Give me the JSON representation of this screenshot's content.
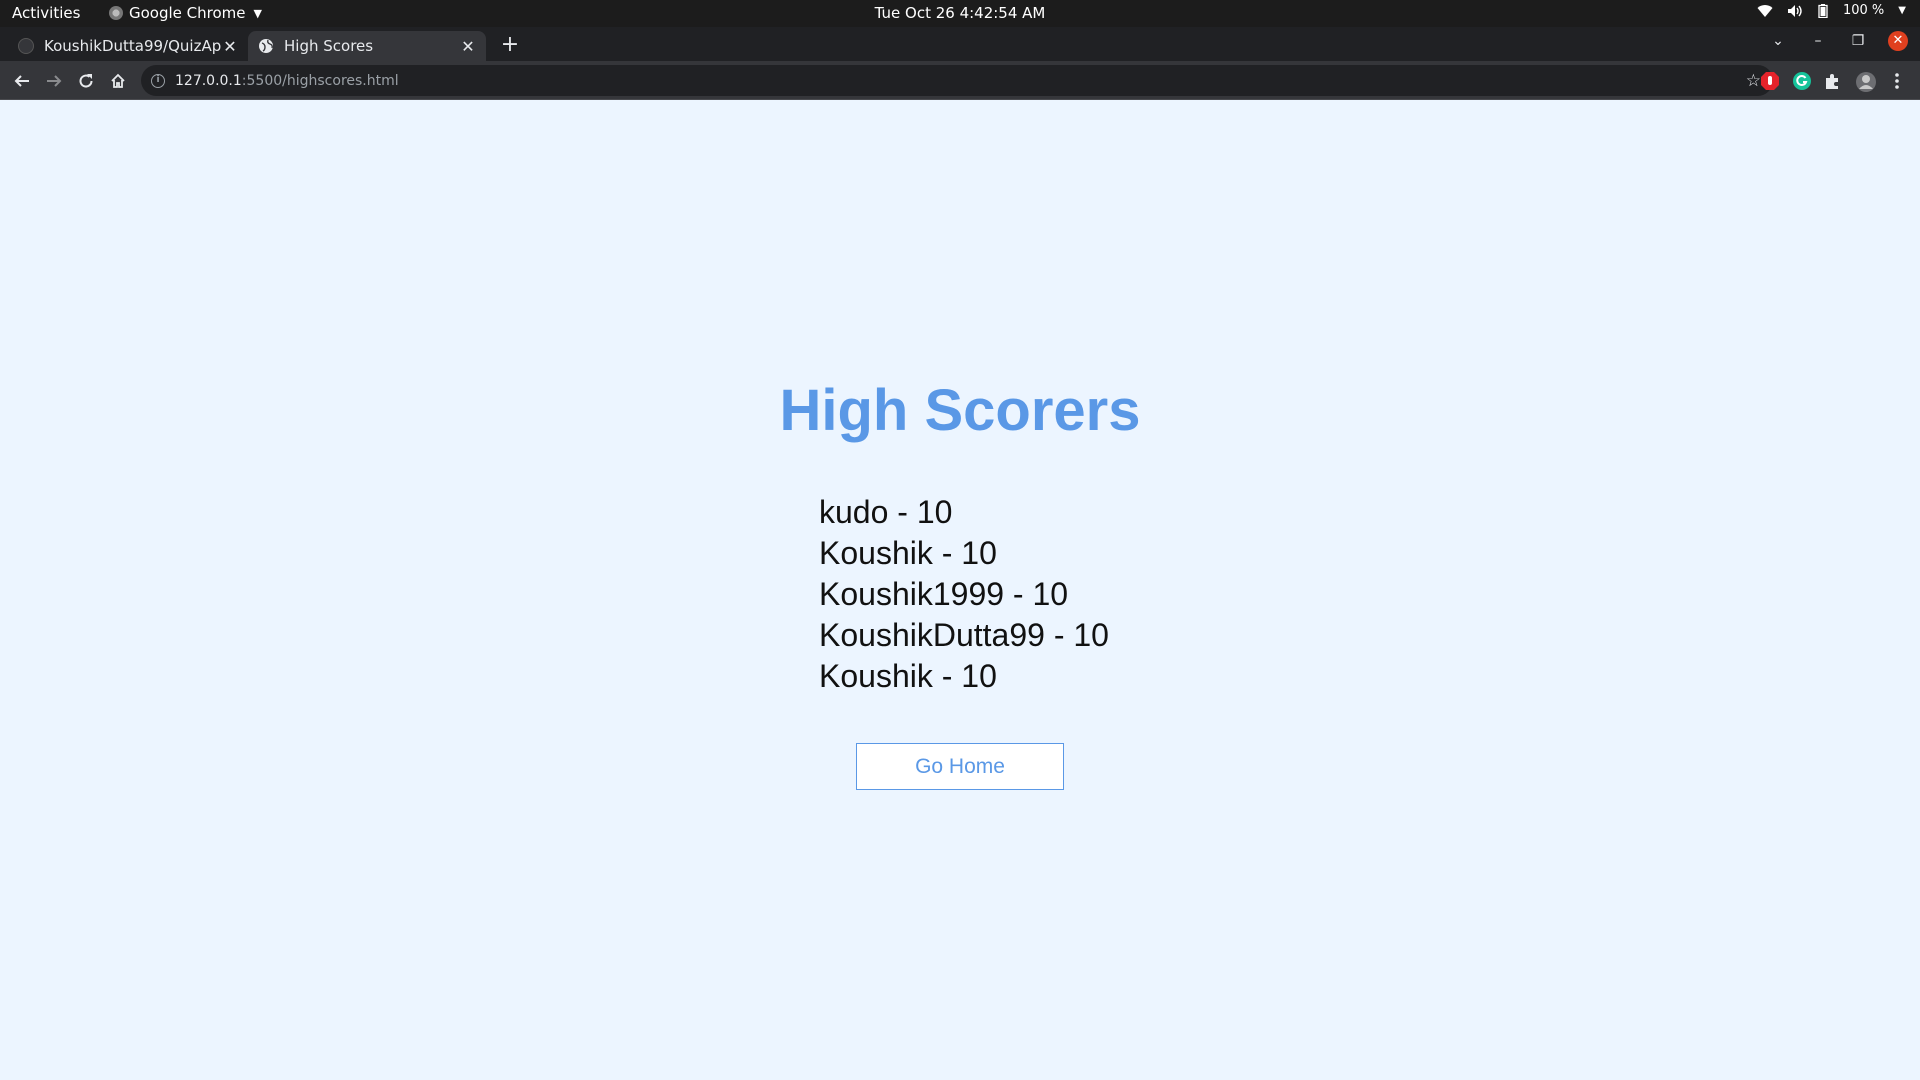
{
  "system_bar": {
    "activities": "Activities",
    "app_name": "Google Chrome",
    "clock": "Tue Oct 26  4:42:54 AM",
    "battery": "100 %"
  },
  "browser": {
    "tabs": [
      {
        "title": "KoushikDutta99/QuizApp",
        "active": false
      },
      {
        "title": "High Scores",
        "active": true
      }
    ],
    "address": {
      "host": "127.0.0.1",
      "path": ":5500/highscores.html"
    }
  },
  "page": {
    "title": "High Scorers",
    "scores": [
      "kudo - 10",
      "Koushik - 10",
      "Koushik1999 - 10",
      "KoushikDutta99 - 10",
      "Koushik - 10"
    ],
    "go_home_label": "Go Home"
  },
  "colors": {
    "page_background": "#ecf5ff",
    "accent": "#5a98e6",
    "toolbar": "#35363a",
    "tabstrip": "#202124"
  }
}
